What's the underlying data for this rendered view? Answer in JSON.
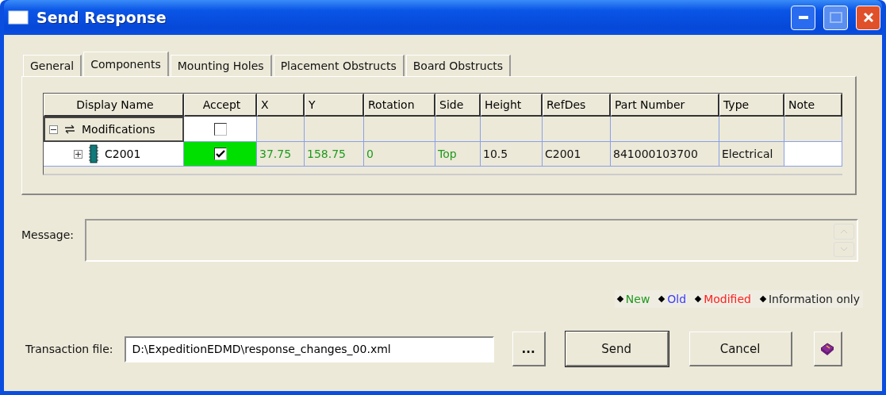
{
  "window": {
    "title": "Send Response"
  },
  "tabs": [
    {
      "label": "General",
      "selected": false
    },
    {
      "label": "Components",
      "selected": true
    },
    {
      "label": "Mounting Holes",
      "selected": false
    },
    {
      "label": "Placement Obstructs",
      "selected": false
    },
    {
      "label": "Board Obstructs",
      "selected": false
    }
  ],
  "table": {
    "columns": [
      "Display Name",
      "Accept",
      "X",
      "Y",
      "Rotation",
      "Side",
      "Height",
      "RefDes",
      "Part Number",
      "Type",
      "Note"
    ],
    "rows": [
      {
        "label": "Modifications",
        "kind": "group",
        "expanded": true,
        "checked": false,
        "children": [
          {
            "label": "C2001",
            "kind": "component",
            "expanded": false,
            "checked": true,
            "cells": [
              {
                "text": "37.75",
                "changed": true
              },
              {
                "text": "158.75",
                "changed": true
              },
              {
                "text": "0",
                "changed": true
              },
              {
                "text": "Top",
                "changed": true
              },
              {
                "text": "10.5",
                "changed": false
              },
              {
                "text": "C2001",
                "changed": false
              },
              {
                "text": "841000103700",
                "changed": false
              },
              {
                "text": "Electrical",
                "changed": false
              }
            ]
          }
        ]
      }
    ]
  },
  "message": {
    "label": "Message:"
  },
  "legend": [
    {
      "label": "New",
      "color": "#1f9a1f"
    },
    {
      "label": "Old",
      "color": "#3b3bff"
    },
    {
      "label": "Modified",
      "color": "#ff2020"
    },
    {
      "label": "Information only",
      "color": "#222222"
    }
  ],
  "transaction": {
    "label": "Transaction file:",
    "value": "D:\\ExpeditionEDMD\\response_changes_00.xml"
  },
  "buttons": {
    "browse": "...",
    "send": "Send",
    "cancel": "Cancel"
  }
}
